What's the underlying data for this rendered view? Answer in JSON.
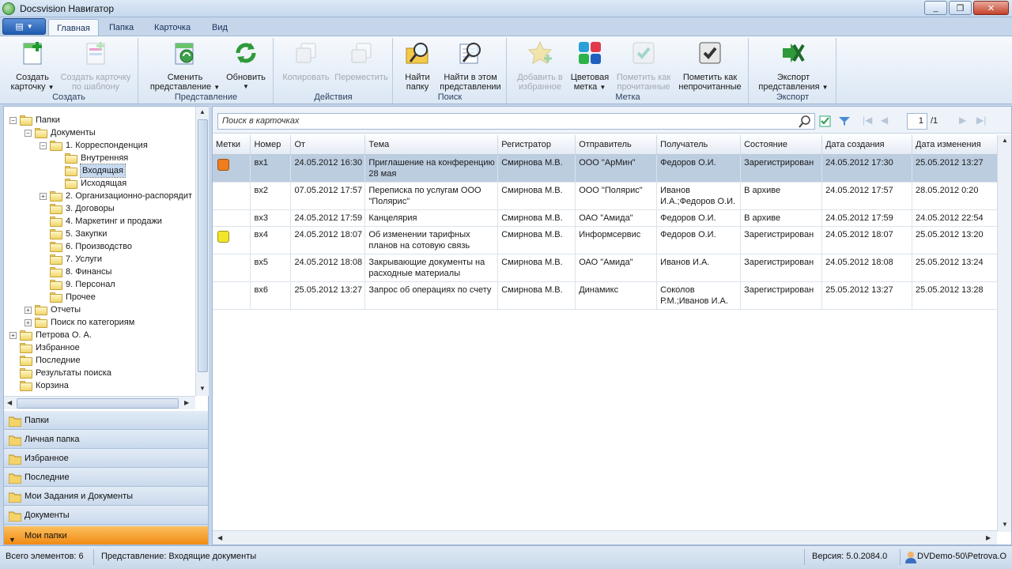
{
  "window": {
    "title": "Docsvision Навигатор"
  },
  "ribbon_tabs": [
    "Главная",
    "Папка",
    "Карточка",
    "Вид"
  ],
  "ribbon": {
    "create": {
      "label": "Создать",
      "create_card_1": "Создать",
      "create_card_2": "карточку",
      "from_template_1": "Создать карточку",
      "from_template_2": "по шаблону"
    },
    "view": {
      "label": "Представление",
      "change_1": "Сменить",
      "change_2": "представление",
      "refresh": "Обновить"
    },
    "actions": {
      "label": "Действия",
      "copy": "Копировать",
      "move": "Переместить"
    },
    "search": {
      "label": "Поиск",
      "find_1": "Найти",
      "find_2": "папку",
      "find_in_1": "Найти в этом",
      "find_in_2": "представлении"
    },
    "mark": {
      "label": "Метка",
      "fav_1": "Добавить в",
      "fav_2": "избранное",
      "color_1": "Цветовая",
      "color_2": "метка",
      "read_1": "Пометить как",
      "read_2": "прочитанные",
      "unread_1": "Пометить как",
      "unread_2": "непрочитанные"
    },
    "export": {
      "label": "Экспорт",
      "exp_1": "Экспорт",
      "exp_2": "представления"
    }
  },
  "tree": [
    {
      "label": "Папки",
      "level": 0,
      "exp": "−"
    },
    {
      "label": "Документы",
      "level": 1,
      "exp": "−"
    },
    {
      "label": "1. Корреспонденция",
      "level": 2,
      "exp": "−"
    },
    {
      "label": "Внутренняя",
      "level": 3,
      "exp": ""
    },
    {
      "label": "Входящая",
      "level": 3,
      "exp": "",
      "selected": true
    },
    {
      "label": "Исходящая",
      "level": 3,
      "exp": ""
    },
    {
      "label": "2. Организационно-распорядит",
      "level": 2,
      "exp": "+"
    },
    {
      "label": "3. Договоры",
      "level": 2,
      "exp": ""
    },
    {
      "label": "4. Маркетинг и продажи",
      "level": 2,
      "exp": ""
    },
    {
      "label": "5. Закупки",
      "level": 2,
      "exp": ""
    },
    {
      "label": "6. Производство",
      "level": 2,
      "exp": ""
    },
    {
      "label": "7. Услуги",
      "level": 2,
      "exp": ""
    },
    {
      "label": "8. Финансы",
      "level": 2,
      "exp": ""
    },
    {
      "label": "9. Персонал",
      "level": 2,
      "exp": ""
    },
    {
      "label": "Прочее",
      "level": 2,
      "exp": ""
    },
    {
      "label": "Отчеты",
      "level": 1,
      "exp": "+"
    },
    {
      "label": "Поиск по категориям",
      "level": 1,
      "exp": "+"
    },
    {
      "label": "Петрова О. А.",
      "level": 0,
      "exp": "+"
    },
    {
      "label": "Избранное",
      "level": 0,
      "exp": ""
    },
    {
      "label": "Последние",
      "level": 0,
      "exp": ""
    },
    {
      "label": "Результаты поиска",
      "level": 0,
      "exp": ""
    },
    {
      "label": "Корзина",
      "level": 0,
      "exp": ""
    }
  ],
  "nav": [
    "Папки",
    "Личная папка",
    "Избранное",
    "Последние",
    "Мои Задания и Документы",
    "Документы",
    "Мои папки"
  ],
  "search": {
    "placeholder": "Поиск в карточках"
  },
  "pager": {
    "current": "1",
    "total": "/1"
  },
  "columns": [
    "Метки",
    "Номер",
    "От",
    "Тема",
    "Регистратор",
    "Отправитель",
    "Получатель",
    "Состояние",
    "Дата создания",
    "Дата изменения"
  ],
  "rows": [
    {
      "mark": "#f07d1e",
      "num": "вх1",
      "from": "24.05.2012 16:30",
      "subject": "Приглашение на конференцию 28 мая",
      "registrar": "Смирнова М.В.",
      "sender": "ООО \"АрМин\"",
      "recipient": "Федоров О.И.",
      "state": "Зарегистрирован",
      "created": "24.05.2012 17:30",
      "modified": "25.05.2012 13:27"
    },
    {
      "mark": "",
      "num": "вх2",
      "from": "07.05.2012 17:57",
      "subject": "Переписка по услугам ООО \"Полярис\"",
      "registrar": "Смирнова М.В.",
      "sender": "ООО \"Полярис\"",
      "recipient": "Иванов И.А.;Федоров О.И.",
      "state": "В архиве",
      "created": "24.05.2012 17:57",
      "modified": "28.05.2012 0:20"
    },
    {
      "mark": "",
      "num": "вх3",
      "from": "24.05.2012 17:59",
      "subject": "Канцелярия",
      "registrar": "Смирнова М.В.",
      "sender": "ОАО \"Амида\"",
      "recipient": "Федоров О.И.",
      "state": "В архиве",
      "created": "24.05.2012 17:59",
      "modified": "24.05.2012 22:54"
    },
    {
      "mark": "#f2e62a",
      "num": "вх4",
      "from": "24.05.2012 18:07",
      "subject": "Об изменении тарифных планов на сотовую связь",
      "registrar": "Смирнова М.В.",
      "sender": "Информсервис",
      "recipient": "Федоров О.И.",
      "state": "Зарегистрирован",
      "created": "24.05.2012 18:07",
      "modified": "25.05.2012 13:20"
    },
    {
      "mark": "",
      "num": "вх5",
      "from": "24.05.2012 18:08",
      "subject": "Закрывающие документы на расходные материалы",
      "registrar": "Смирнова М.В.",
      "sender": "ОАО \"Амида\"",
      "recipient": "Иванов И.А.",
      "state": "Зарегистрирован",
      "created": "24.05.2012 18:08",
      "modified": "25.05.2012 13:24"
    },
    {
      "mark": "",
      "num": "вх6",
      "from": "25.05.2012 13:27",
      "subject": "Запрос об операциях по счету",
      "registrar": "Смирнова М.В.",
      "sender": "Динамикс",
      "recipient": "Соколов Р.М.;Иванов И.А.",
      "state": "Зарегистрирован",
      "created": "25.05.2012 13:27",
      "modified": "25.05.2012 13:28"
    }
  ],
  "status": {
    "count": "Всего элементов: 6",
    "view": "Представление: Входящие документы",
    "version": "Версия: 5.0.2084.0",
    "user": "DVDemo-50\\Petrova.O"
  },
  "colors": {
    "accent": "#1f5bb0",
    "selection": "#bccde0",
    "nav_active": "#f08a12"
  }
}
